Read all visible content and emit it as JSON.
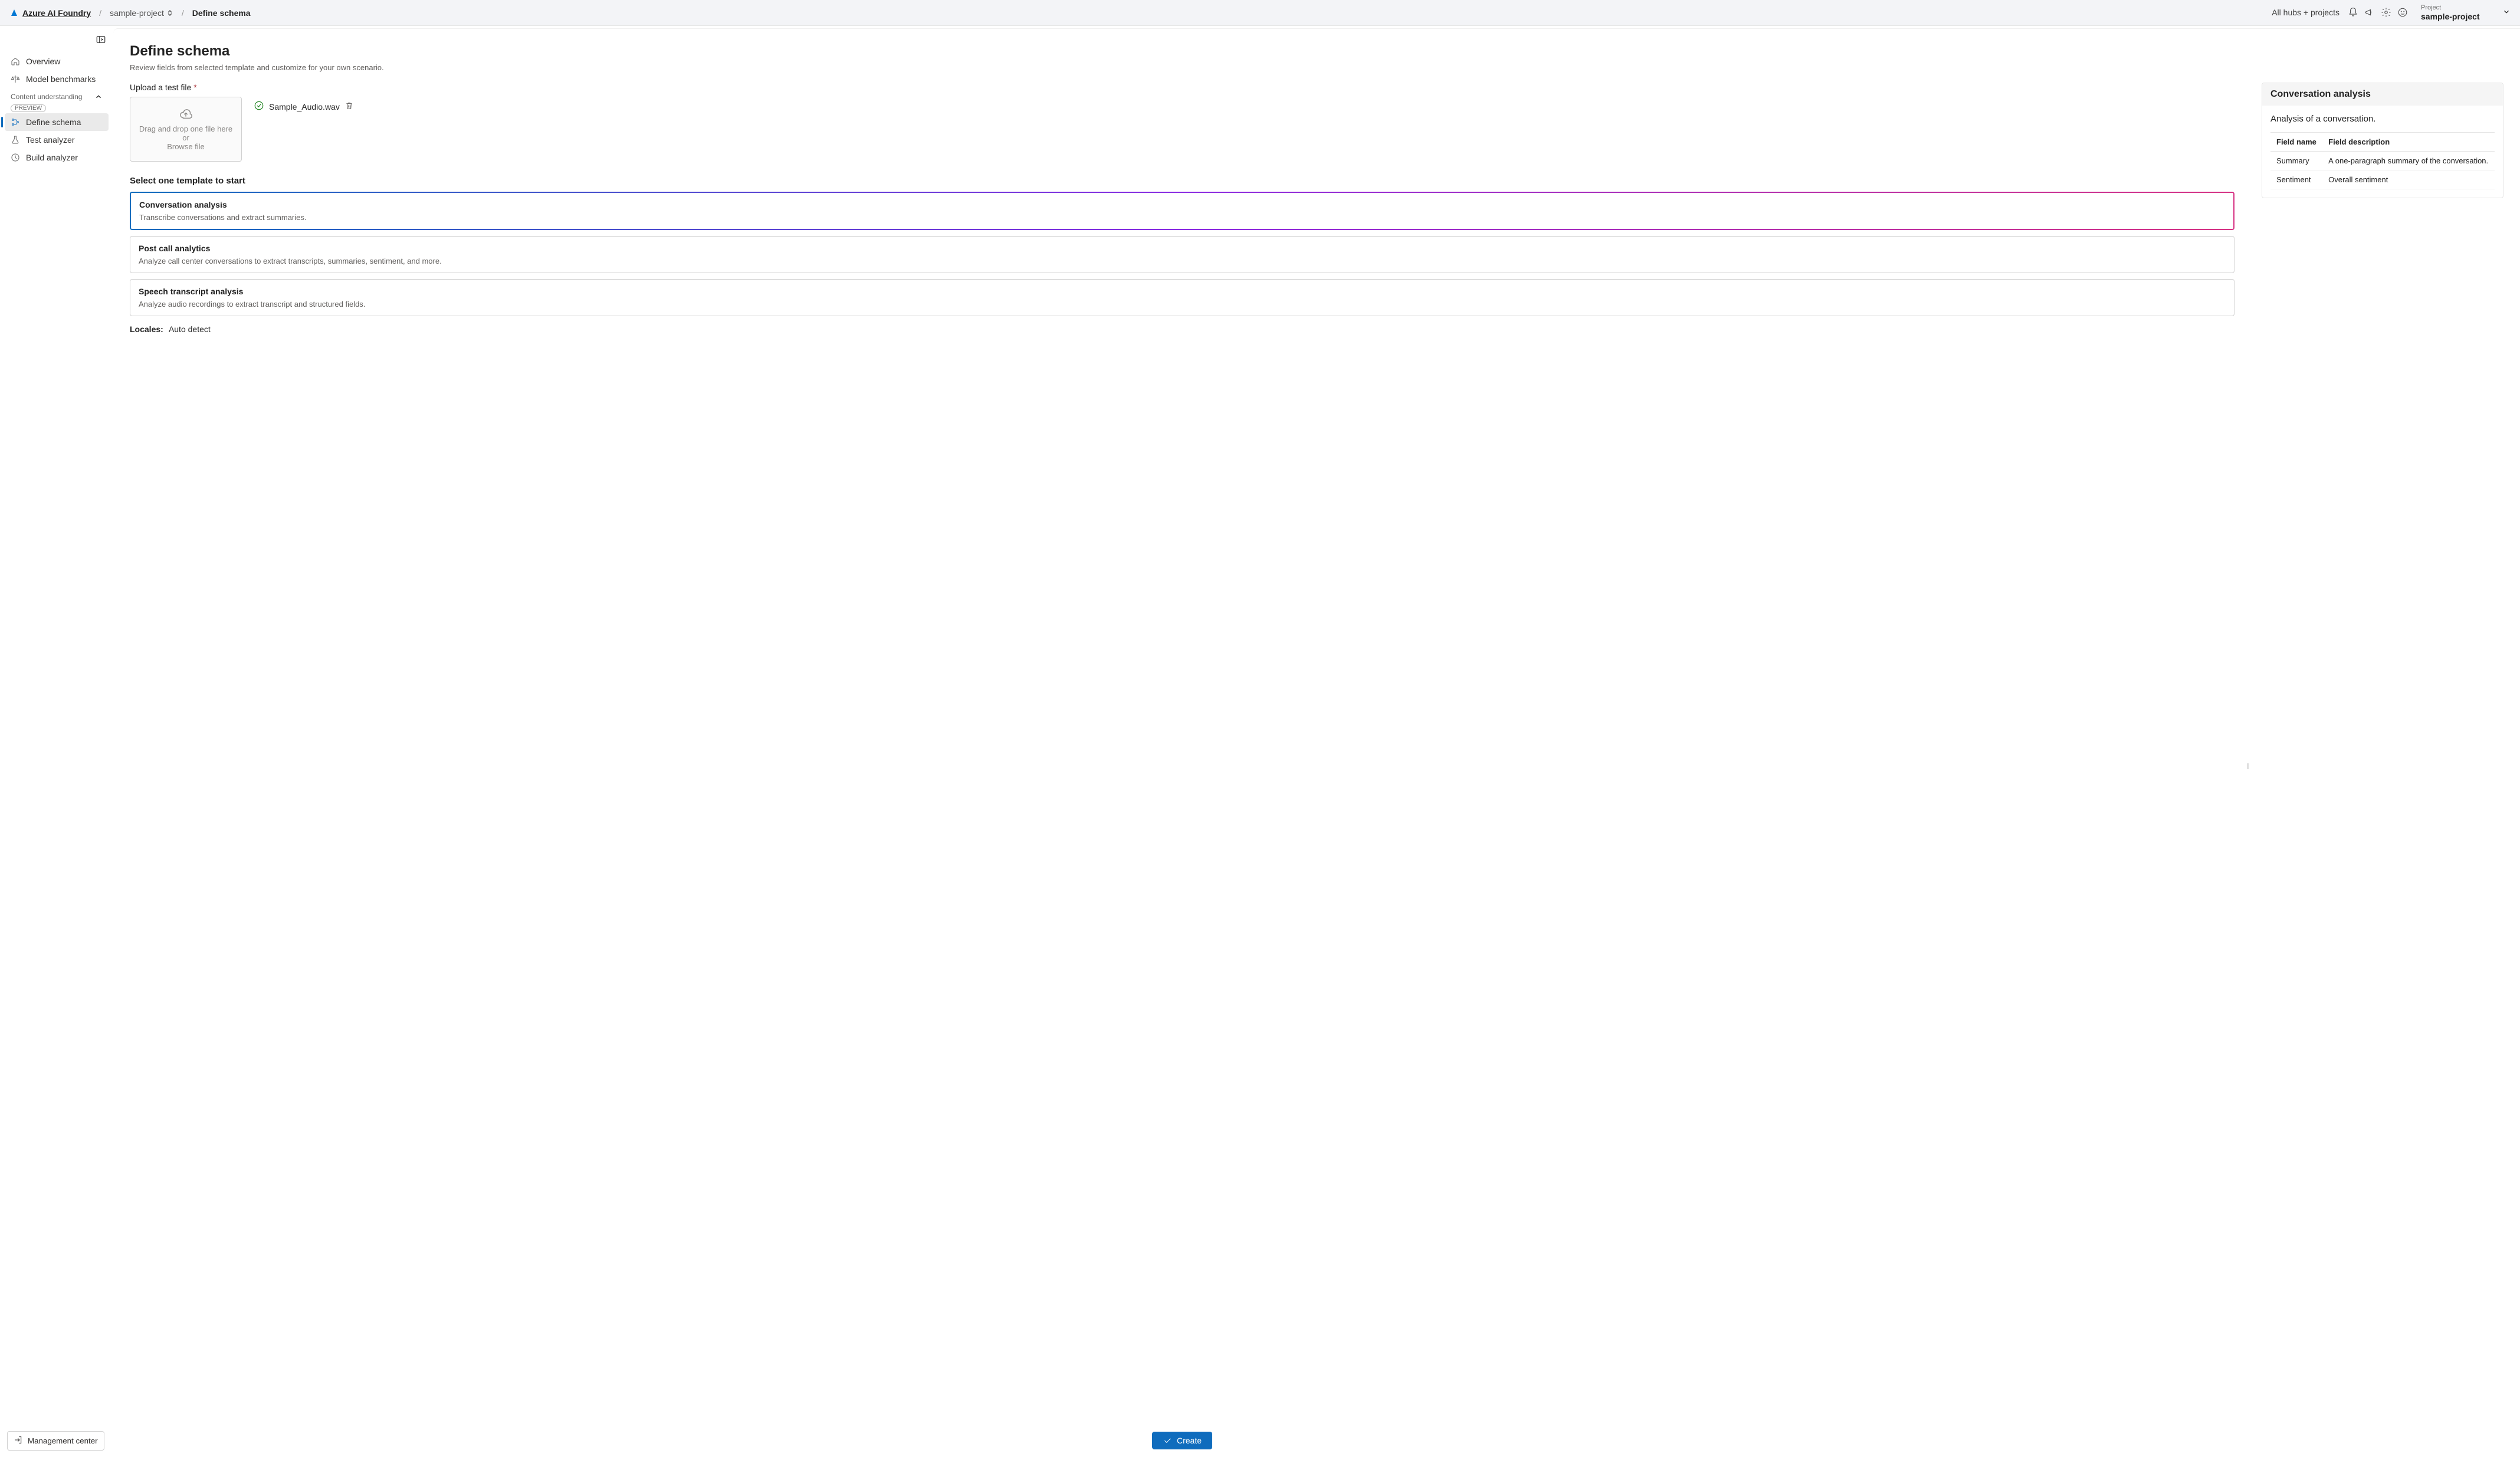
{
  "header": {
    "brand": "Azure AI Foundry",
    "breadcrumb_project": "sample-project",
    "breadcrumb_current": "Define schema",
    "hubs": "All hubs + projects",
    "project_label": "Project",
    "project_value": "sample-project"
  },
  "sidebar": {
    "items": {
      "overview": "Overview",
      "benchmarks": "Model benchmarks"
    },
    "group": {
      "title": "Content understanding",
      "preview": "PREVIEW",
      "items": {
        "define": "Define schema",
        "test": "Test analyzer",
        "build": "Build analyzer"
      }
    },
    "management": "Management center"
  },
  "main": {
    "title": "Define schema",
    "subtitle": "Review fields from selected template and customize for your own scenario.",
    "upload_label": "Upload a test file",
    "drop_text1": "Drag and drop one file here or",
    "drop_text2": "Browse file",
    "file_name": "Sample_Audio.wav",
    "templates_title": "Select one template to start",
    "templates": [
      {
        "title": "Conversation analysis",
        "desc": "Transcribe conversations and extract summaries."
      },
      {
        "title": "Post call analytics",
        "desc": "Analyze call center conversations to extract transcripts, summaries, sentiment, and more."
      },
      {
        "title": "Speech transcript analysis",
        "desc": "Analyze audio recordings to extract transcript and structured fields."
      }
    ],
    "locales_label": "Locales:",
    "locales_value": "Auto detect",
    "create": "Create"
  },
  "panel": {
    "title": "Conversation analysis",
    "desc": "Analysis of a conversation.",
    "col_name": "Field name",
    "col_desc": "Field description",
    "rows": [
      {
        "name": "Summary",
        "desc": "A one-paragraph summary of the conversation."
      },
      {
        "name": "Sentiment",
        "desc": "Overall sentiment"
      }
    ]
  }
}
